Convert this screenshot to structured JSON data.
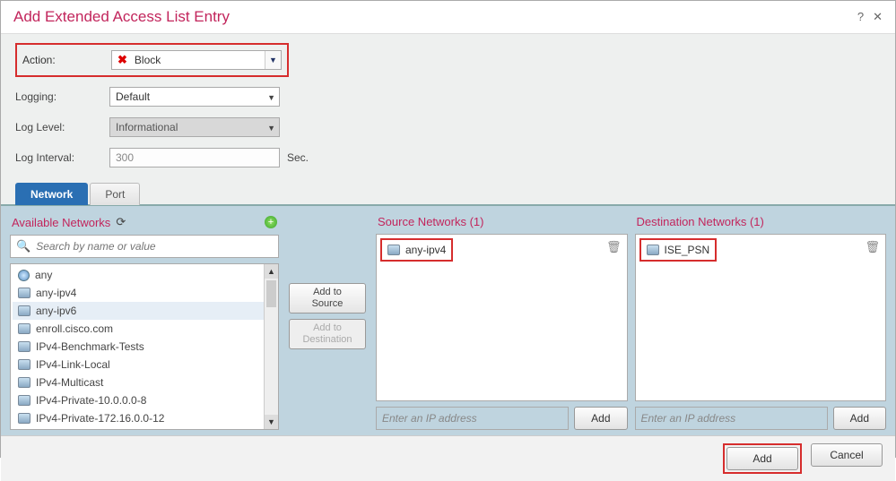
{
  "title": "Add Extended Access List Entry",
  "form": {
    "action_label": "Action:",
    "action_value": "Block",
    "logging_label": "Logging:",
    "logging_value": "Default",
    "loglevel_label": "Log Level:",
    "loglevel_value": "Informational",
    "loginterval_label": "Log Interval:",
    "loginterval_value": "300",
    "loginterval_unit": "Sec."
  },
  "tabs": {
    "network": "Network",
    "port": "Port"
  },
  "available": {
    "header": "Available Networks",
    "search_placeholder": "Search by name or value",
    "items": [
      "any",
      "any-ipv4",
      "any-ipv6",
      "enroll.cisco.com",
      "IPv4-Benchmark-Tests",
      "IPv4-Link-Local",
      "IPv4-Multicast",
      "IPv4-Private-10.0.0.0-8",
      "IPv4-Private-172.16.0.0-12"
    ],
    "selected_index": 2
  },
  "mid": {
    "add_source_l1": "Add to",
    "add_source_l2": "Source",
    "add_dest_l1": "Add to",
    "add_dest_l2": "Destination"
  },
  "source": {
    "header": "Source Networks (1)",
    "item": "any-ipv4",
    "ip_placeholder": "Enter an IP address",
    "add_btn": "Add"
  },
  "dest": {
    "header": "Destination Networks (1)",
    "item": "ISE_PSN",
    "ip_placeholder": "Enter an IP address",
    "add_btn": "Add"
  },
  "footer": {
    "add": "Add",
    "cancel": "Cancel"
  }
}
